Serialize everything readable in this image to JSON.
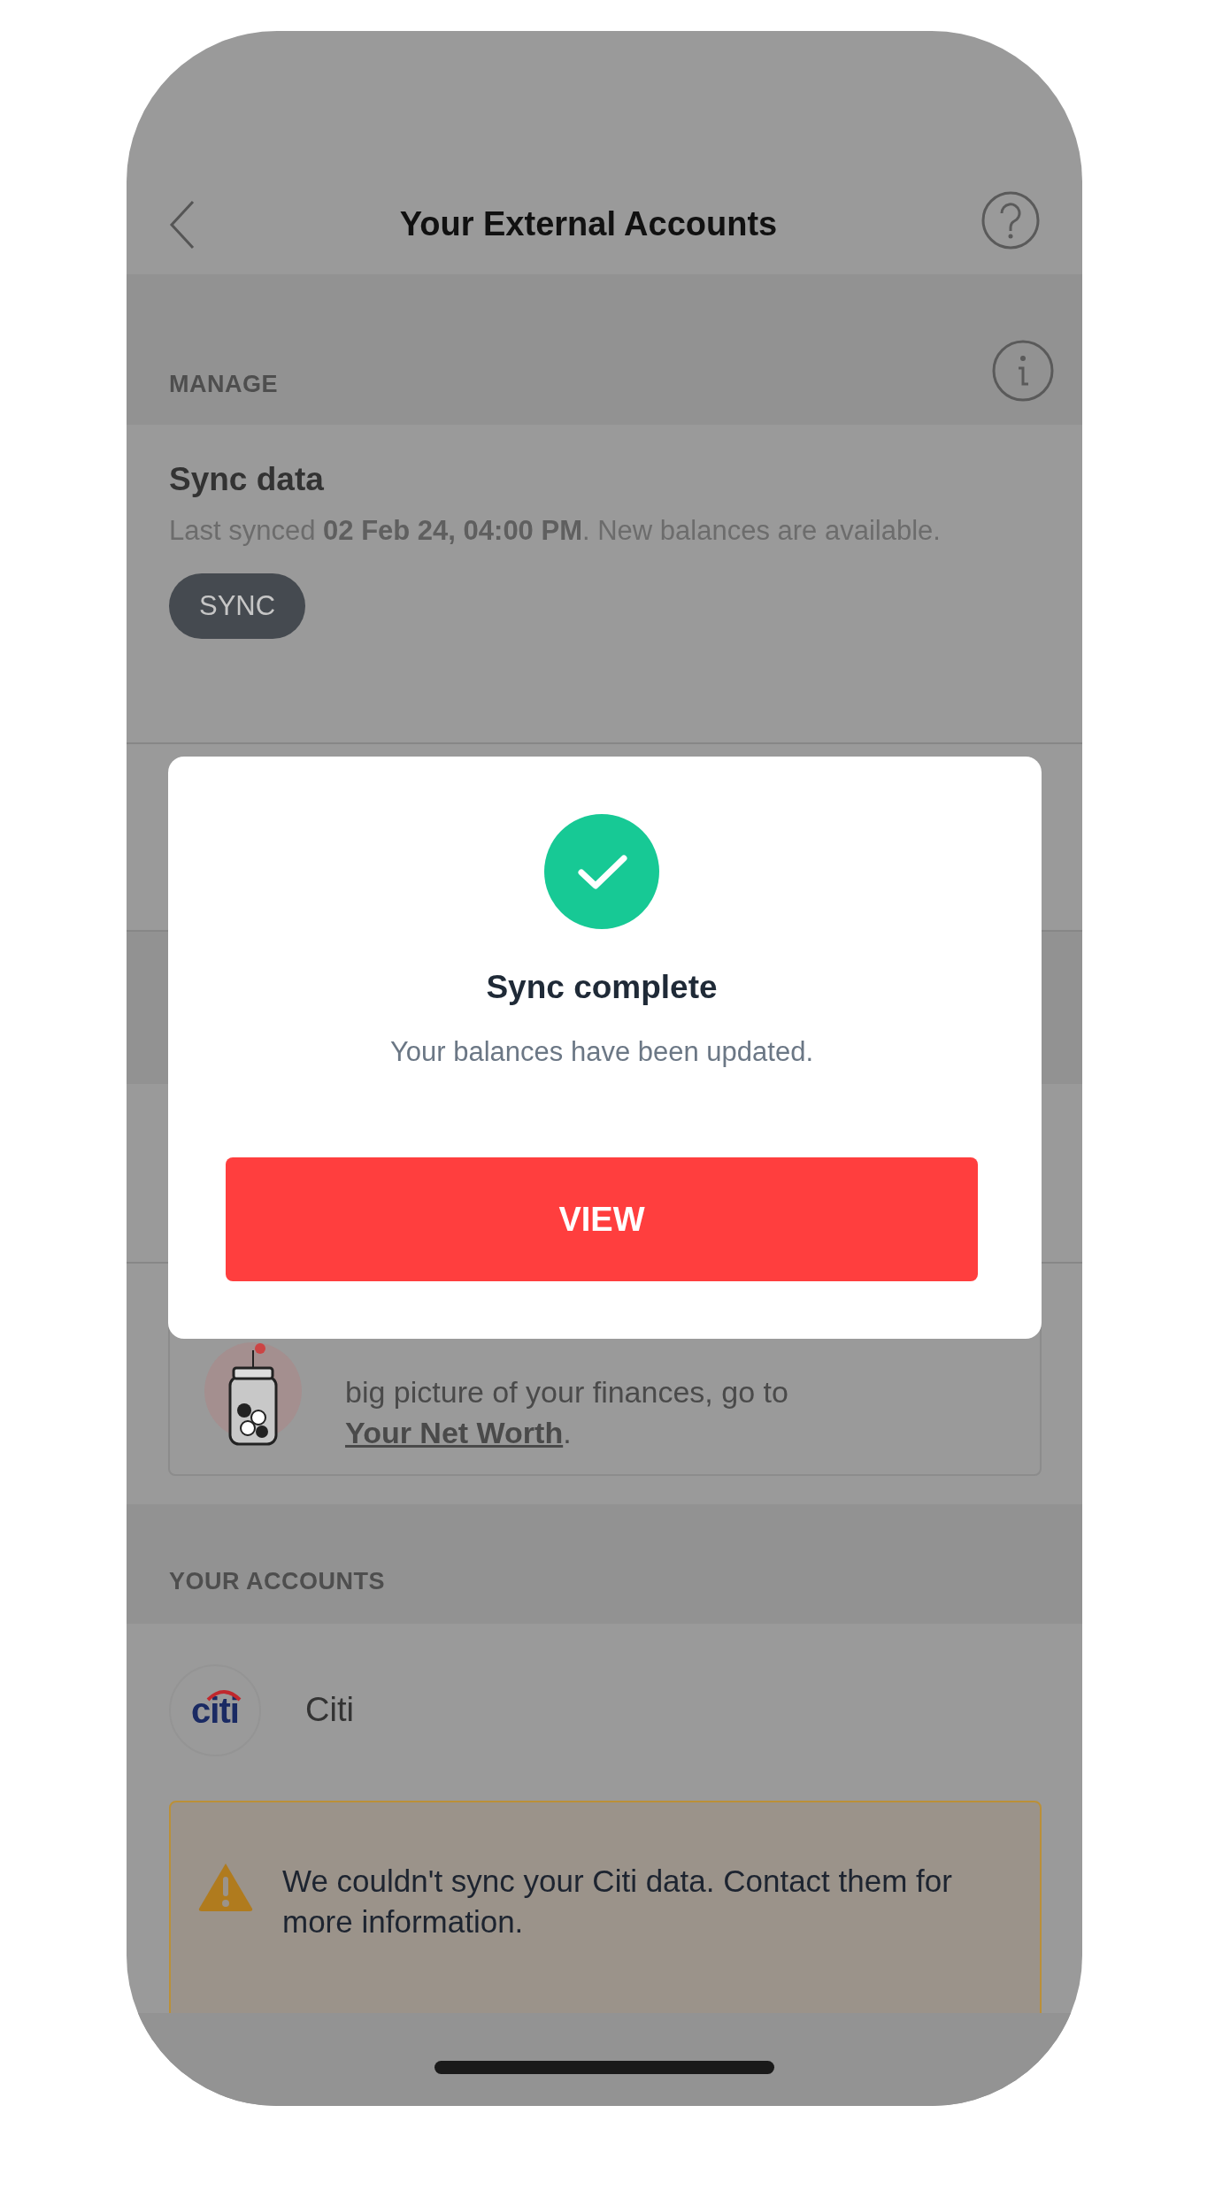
{
  "header": {
    "title": "Your External Accounts"
  },
  "manage": {
    "heading": "MANAGE",
    "sync_card": {
      "title": "Sync data",
      "text": "Last synced **02 Feb 24, 04:00 PM**. New balances are available.",
      "button": "SYNC"
    }
  },
  "net_worth_banner": {
    "text": "big picture of your finances, go to",
    "link": "Your Net Worth",
    "tail": "."
  },
  "accounts": {
    "heading": "YOUR ACCOUNTS",
    "items": [
      {
        "name": "Citi",
        "logo_text": "citi",
        "warning": "We couldn't sync your Citi data. Contact them for more information."
      }
    ]
  },
  "dialog": {
    "title": "Sync complete",
    "message": "Your balances have been updated.",
    "button": "VIEW"
  }
}
